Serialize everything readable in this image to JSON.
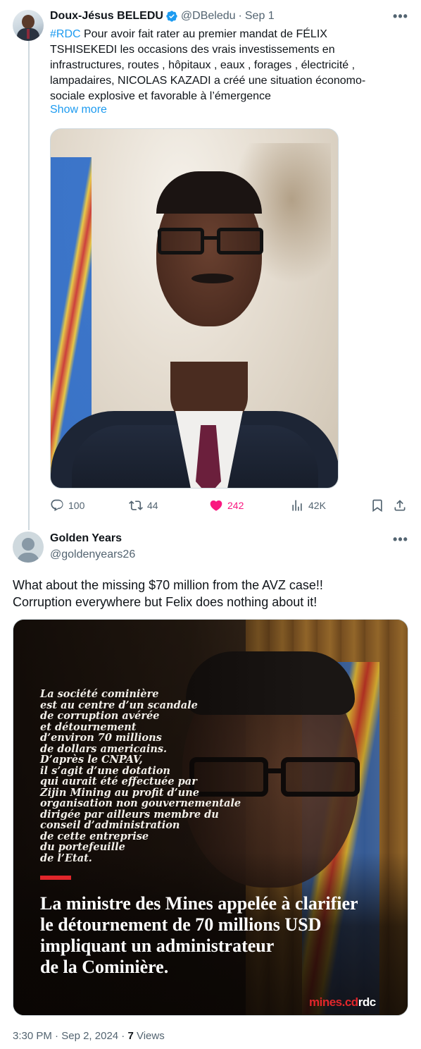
{
  "tweet1": {
    "author_name": "Doux-Jésus BELEDU",
    "handle": "@DBeledu",
    "separator": "·",
    "date": "Sep 1",
    "more_glyph": "•••",
    "text_lines": [
      {
        "hashtag": "#RDC",
        "rest": " Pour avoir fait rater au premier mandat de FÉLIX"
      },
      {
        "hashtag": "",
        "rest": "TSHISEKEDI les occasions des vrais investissements en"
      },
      {
        "hashtag": "",
        "rest": "infrastructures, routes , hôpitaux , eaux , forages , électricité ,"
      },
      {
        "hashtag": "",
        "rest": "lampadaires, NICOLAS KAZADI a  créé une situation économo-"
      },
      {
        "hashtag": "",
        "rest": "sociale explosive et favorable à l’émergence"
      }
    ],
    "show_more": "Show more",
    "actions": {
      "replies": "100",
      "retweets": "44",
      "likes": "242",
      "views": "42K"
    },
    "colors": {
      "like": "#f91880",
      "link": "#1d9bf0",
      "verified": "#1d9bf0"
    }
  },
  "tweet2": {
    "author_name": "Golden Years",
    "handle": "@goldenyears26",
    "more_glyph": "•••",
    "body_lines": [
      "What about the missing $70 million from the AVZ case!!",
      "Corruption everywhere but Felix does nothing about it!"
    ],
    "image": {
      "paragraph_lines": [
        "La société cominière",
        "est au centre d’un scandale",
        "de corruption avérée",
        "et détournement",
        "d’environ 70 millions",
        "de dollars americains.",
        "D’après le CNPAV,",
        "il s’agit d’une dotation",
        "qui aurait été effectuée par",
        "Zijin Mining au profit d’une",
        "organisation non gouvernementale",
        "dirigée par ailleurs membre du",
        "conseil d’administration",
        "de cette entreprise",
        "du portefeuille",
        "de l’Etat."
      ],
      "headline_lines": [
        "La ministre des Mines appelée à clarifier",
        "le détournement de 70 millions USD",
        "impliquant un administrateur",
        "de la Cominière."
      ],
      "brand_left": "mines.cd",
      "brand_right": "rdc",
      "accent_red": "#e0262b"
    },
    "meta": {
      "time": "3:30 PM",
      "dot1": " · ",
      "date": "Sep 2, 2024",
      "dot2": " · ",
      "views_count": "7",
      "views_label": " Views"
    }
  }
}
